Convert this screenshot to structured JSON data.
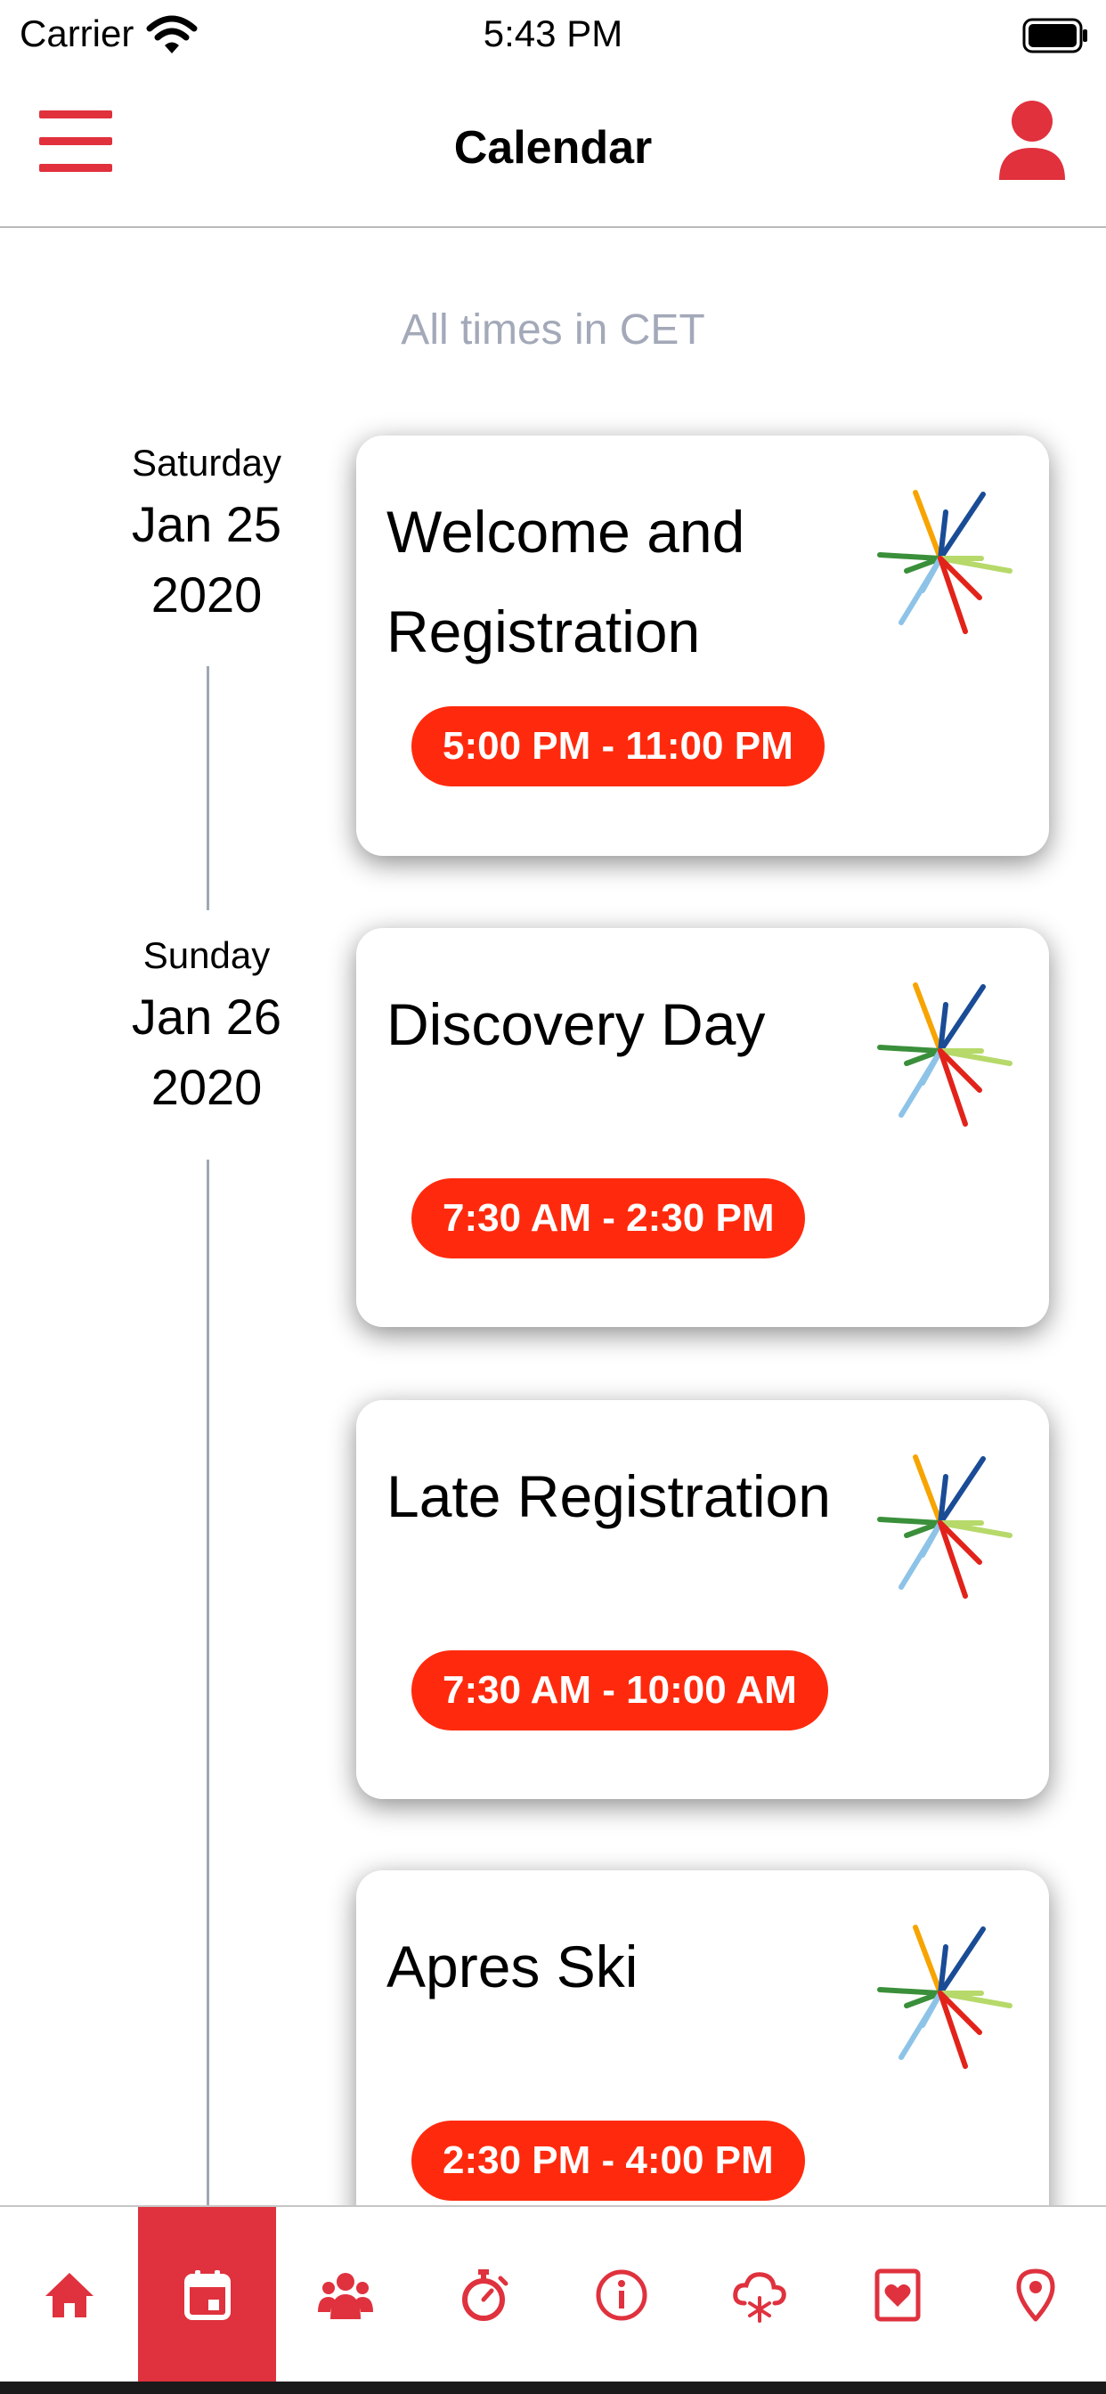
{
  "status_bar": {
    "carrier": "Carrier",
    "time": "5:43 PM"
  },
  "nav": {
    "title": "Calendar"
  },
  "note": "All times in CET",
  "dates": [
    {
      "weekday": "Saturday",
      "month_day": "Jan 25",
      "year": "2020"
    },
    {
      "weekday": "Sunday",
      "month_day": "Jan 26",
      "year": "2020"
    }
  ],
  "events": [
    {
      "title": "Welcome and Registration",
      "time": "5:00 PM - 11:00 PM"
    },
    {
      "title": "Discovery Day",
      "time": "7:30 AM - 2:30 PM"
    },
    {
      "title": "Late Registration",
      "time": "7:30 AM - 10:00 AM"
    },
    {
      "title": "Apres Ski",
      "time": "2:30 PM - 4:00 PM"
    }
  ],
  "tabs": [
    {
      "icon": "home-icon"
    },
    {
      "icon": "calendar-icon",
      "active": true
    },
    {
      "icon": "people-icon"
    },
    {
      "icon": "stopwatch-icon"
    },
    {
      "icon": "info-icon"
    },
    {
      "icon": "snow-cloud-icon"
    },
    {
      "icon": "heart-card-icon"
    },
    {
      "icon": "location-pin-icon"
    }
  ],
  "colors": {
    "accent": "#df323e",
    "time_pill": "#ff2a0d",
    "muted_text": "#a3a9b8"
  }
}
